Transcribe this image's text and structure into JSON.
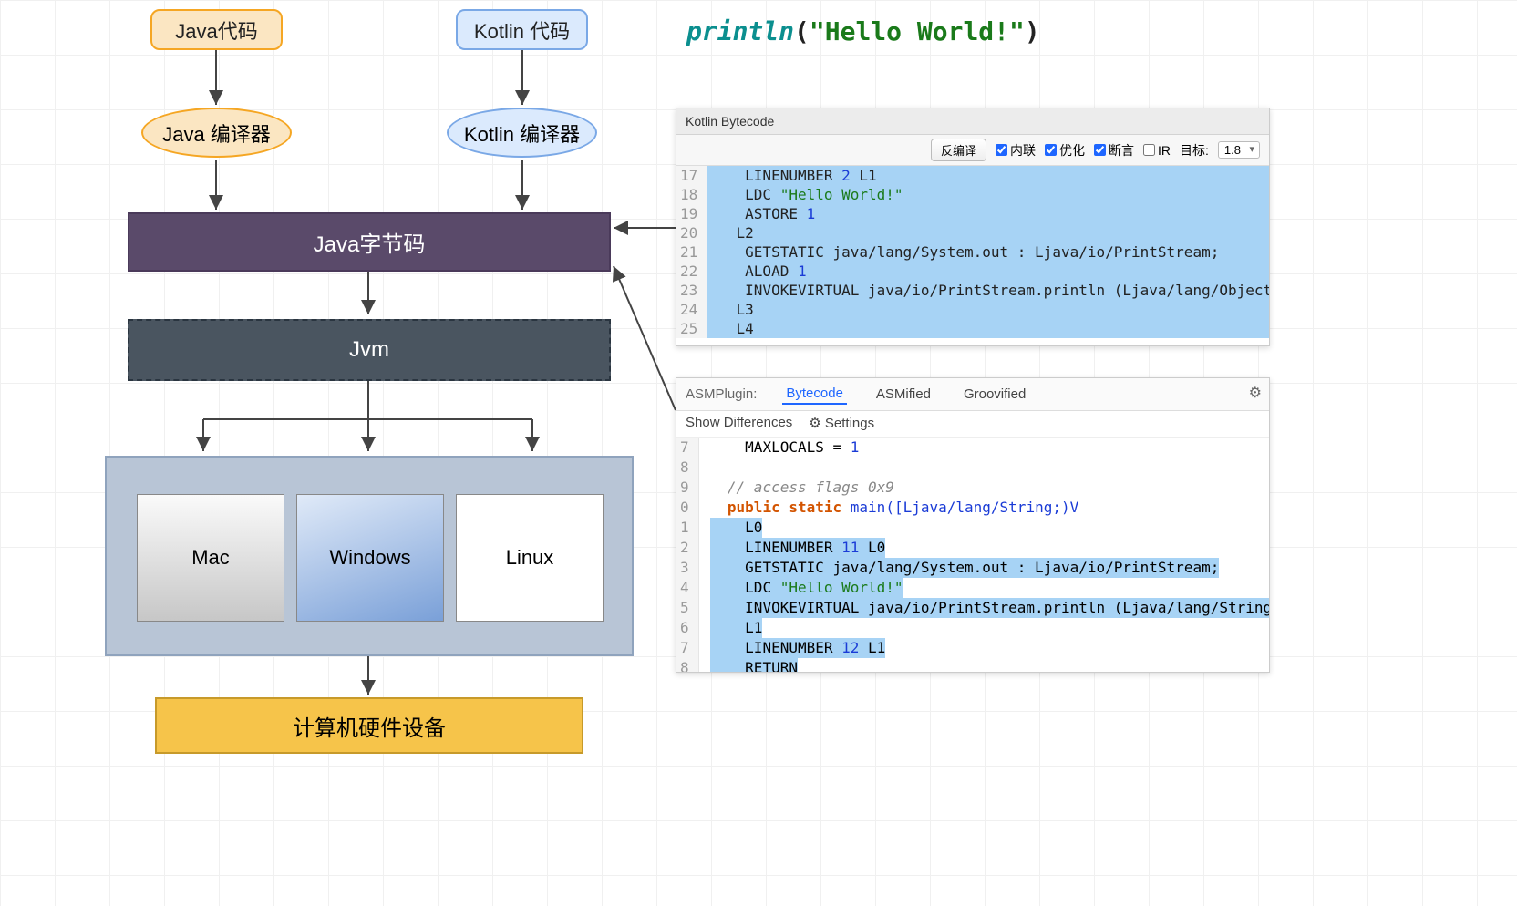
{
  "diagram": {
    "java_code": "Java代码",
    "kotlin_code": "Kotlin 代码",
    "java_compiler": "Java 编译器",
    "kotlin_compiler": "Kotlin 编译器",
    "bytecode": "Java字节码",
    "jvm": "Jvm",
    "os": {
      "mac": "Mac",
      "windows": "Windows",
      "linux": "Linux"
    },
    "hardware": "计算机硬件设备"
  },
  "snippet": {
    "fn": "println",
    "str": "\"Hello World!\""
  },
  "kotlin_panel": {
    "title": "Kotlin Bytecode",
    "decompile": "反编译",
    "chk_inline": "内联",
    "chk_opt": "优化",
    "chk_assert": "断言",
    "chk_ir": "IR",
    "target_label": "目标:",
    "target_value": "1.8",
    "lines": [
      "17",
      "18",
      "19",
      "20",
      "21",
      "22",
      "23",
      "24",
      "25"
    ],
    "code": [
      "   LINENUMBER 2 L1",
      "   LDC \"Hello World!\"",
      "   ASTORE 1",
      "  L2",
      "   GETSTATIC java/lang/System.out : Ljava/io/PrintStream;",
      "   ALOAD 1",
      "   INVOKEVIRTUAL java/io/PrintStream.println (Ljava/lang/Object;)V",
      "  L3",
      "  L4"
    ]
  },
  "asm_panel": {
    "plugin_label": "ASMPlugin:",
    "tabs": {
      "bytecode": "Bytecode",
      "asmified": "ASMified",
      "groovified": "Groovified"
    },
    "show_diff": "Show Differences",
    "settings": "Settings",
    "lines": [
      "7",
      "8",
      "9",
      "0",
      "1",
      "2",
      "3",
      "4",
      "5",
      "6",
      "7",
      "8"
    ],
    "code": {
      "maxlocals": "    MAXLOCALS = 1",
      "comment": "  // access flags 0x9",
      "sig_pre": "  public static ",
      "sig_main": "main([Ljava/lang/String;)V",
      "l0": "    L0",
      "ln11": "    LINENUMBER 11 L0",
      "getstatic": "    GETSTATIC java/lang/System.out : Ljava/io/PrintStream;",
      "ldc_pre": "    LDC ",
      "ldc_str": "\"Hello World!\"",
      "invoke": "    INVOKEVIRTUAL java/io/PrintStream.println (Ljava/lang/String;)V",
      "l1": "    L1",
      "ln12": "    LINENUMBER 12 L1",
      "ret": "    RETURN"
    }
  }
}
